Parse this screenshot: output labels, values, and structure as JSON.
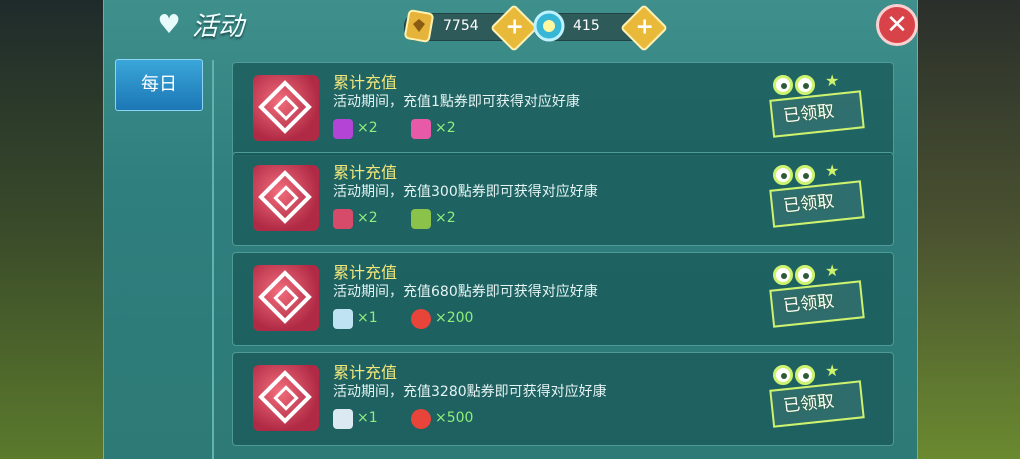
{
  "header": {
    "title": "活动",
    "currency1": {
      "icon": "gem-voucher-icon",
      "value": "7754"
    },
    "currency2": {
      "icon": "sun-coin-icon",
      "value": "415"
    },
    "plus": "+",
    "close": "✕"
  },
  "sidebar": {
    "tabs": [
      {
        "label": "每日"
      }
    ]
  },
  "cards": [
    {
      "title": "累计充值",
      "desc": "活动期间，充值1點券即可获得对应好康",
      "rewards": [
        {
          "icon": "purple-gem-icon",
          "text": "×2"
        },
        {
          "icon": "pink-chest-icon",
          "text": "×2"
        }
      ],
      "status": "已领取"
    },
    {
      "title": "累计充值",
      "desc": "活动期间，充值300點券即可获得对应好康",
      "rewards": [
        {
          "icon": "red-crystal-icon",
          "text": "×2"
        },
        {
          "icon": "gift-box-icon",
          "text": "×2"
        }
      ],
      "status": "已领取"
    },
    {
      "title": "累计充值",
      "desc": "活动期间，充值680點券即可获得对应好康",
      "rewards": [
        {
          "icon": "blue-pet-icon",
          "text": "×1"
        },
        {
          "icon": "red-orb-icon",
          "text": "×200"
        }
      ],
      "status": "已领取"
    },
    {
      "title": "累计充值",
      "desc": "活动期间，充值3280點券即可获得对应好康",
      "rewards": [
        {
          "icon": "feather-quill-icon",
          "text": "×1"
        },
        {
          "icon": "red-orb-icon",
          "text": "×500"
        }
      ],
      "status": "已领取"
    }
  ],
  "colors": {
    "panel": "#2f7f7f",
    "accent_green": "#8ef07a",
    "title_yellow": "#f3e77a"
  }
}
